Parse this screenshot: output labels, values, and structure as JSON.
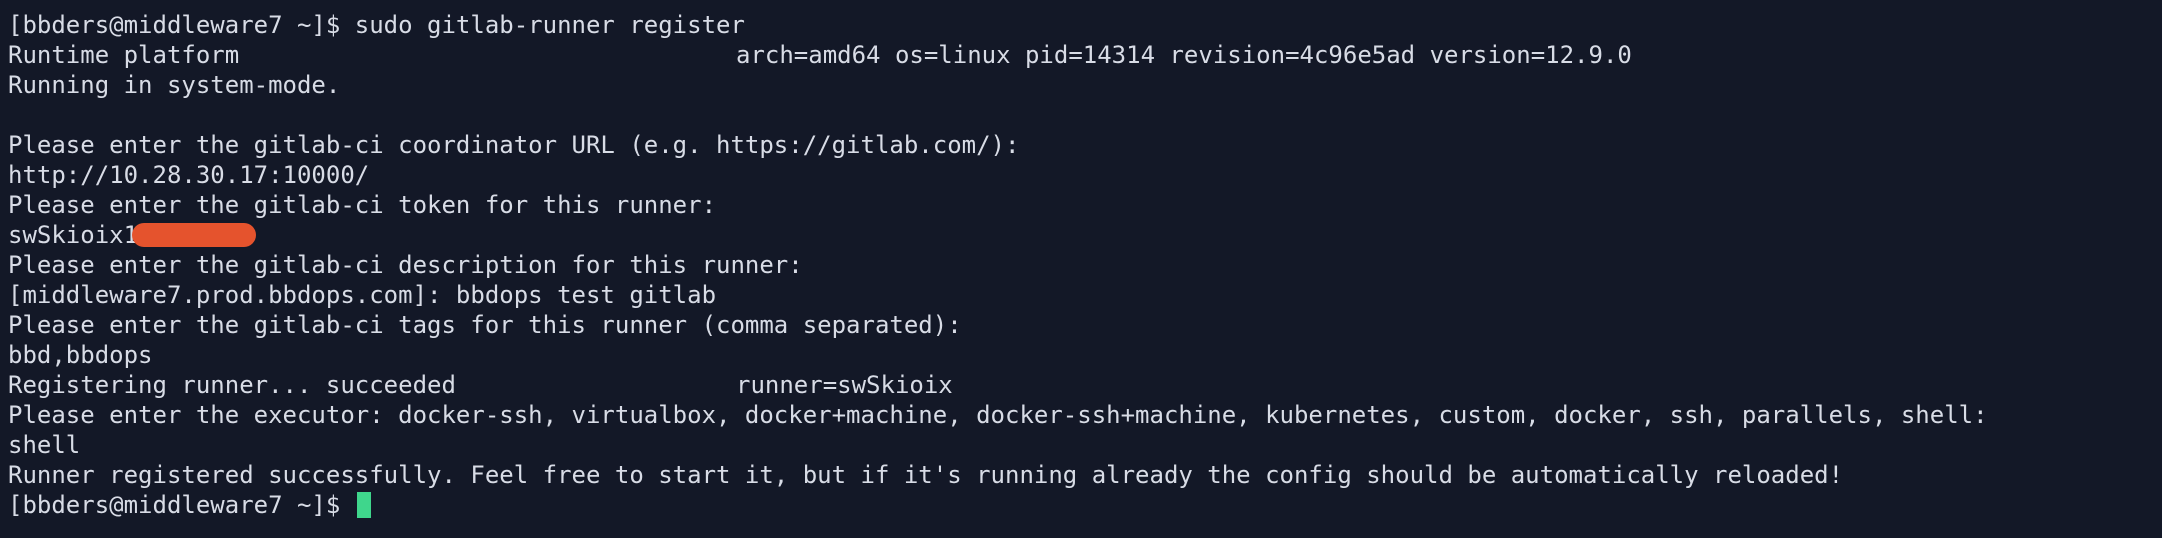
{
  "colors": {
    "background": "#131827",
    "text": "#d8dce6",
    "redaction": "#e5532d",
    "cursor": "#3fd68c"
  },
  "terminal": {
    "prompt": "[bbders@middleware7 ~]$ ",
    "command": "sudo gitlab-runner register",
    "runtime_label": "Runtime platform",
    "runtime_info": "arch=amd64 os=linux pid=14314 revision=4c96e5ad version=12.9.0",
    "mode": "Running in system-mode.",
    "q_url": "Please enter the gitlab-ci coordinator URL (e.g. https://gitlab.com/):",
    "a_url": "http://10.28.30.17:10000/",
    "q_token": "Please enter the gitlab-ci token for this runner:",
    "a_token_visible": "swSkioix1",
    "q_description": "Please enter the gitlab-ci description for this runner:",
    "a_description": "[middleware7.prod.bbdops.com]: bbdops test gitlab",
    "q_tags": "Please enter the gitlab-ci tags for this runner (comma separated):",
    "a_tags": "bbd,bbdops",
    "registering": "Registering runner... succeeded",
    "runner_id": "runner=swSkioix",
    "q_executor": "Please enter the executor: docker-ssh, virtualbox, docker+machine, docker-ssh+machine, kubernetes, custom, docker, ssh, parallels, shell:",
    "a_executor": "shell",
    "success": "Runner registered successfully. Feel free to start it, but if it's running already the config should be automatically reloaded!",
    "final_prompt": "[bbders@middleware7 ~]$ "
  }
}
